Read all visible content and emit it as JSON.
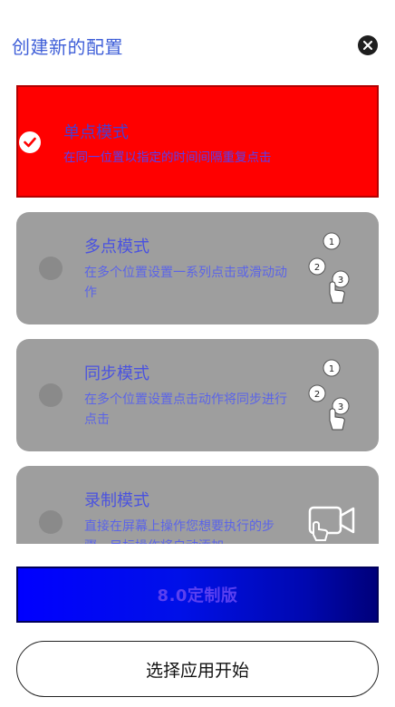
{
  "header": {
    "title": "创建新的配置",
    "close_icon": "close-icon"
  },
  "modes": [
    {
      "name": "单点模式",
      "desc": "在同一位置以指定的时间间隔重复点击",
      "selected": true
    },
    {
      "name": "多点模式",
      "desc": "在多个位置设置一系列点击或滑动动作",
      "selected": false,
      "art": [
        "1",
        "2",
        "3"
      ]
    },
    {
      "name": "同步模式",
      "desc": "在多个位置设置点击动作将同步进行点击",
      "selected": false,
      "art": [
        "1",
        "2",
        "3"
      ]
    },
    {
      "name": "录制模式",
      "desc": "直接在屏幕上操作您想要执行的步骤，目标操作将自动添加",
      "selected": false
    }
  ],
  "banner": {
    "label": "8.0定制版"
  },
  "start_button": {
    "label": "选择应用开始"
  },
  "colors": {
    "selected": "#ff0000",
    "unselected": "#9e9e9e",
    "accent": "#3f5fd8"
  }
}
